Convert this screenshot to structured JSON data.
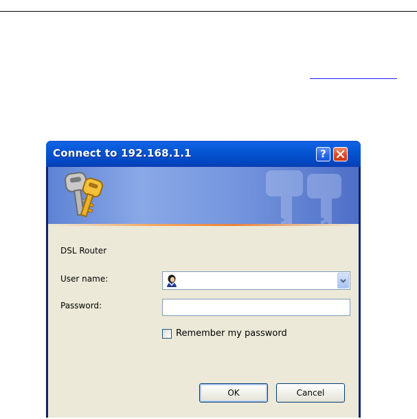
{
  "dialog": {
    "title": "Connect to 192.168.1.1",
    "help_button": "?",
    "realm": "DSL Router",
    "user_name_label": "User name:",
    "user_name_value": "",
    "password_label": "Password:",
    "password_value": "",
    "remember_label": "Remember my password",
    "remember_checked": false,
    "ok_label": "OK",
    "cancel_label": "Cancel"
  },
  "icons": {
    "banner": "keys-icon",
    "user_field": "user-icon",
    "dropdown": "chevron-down-icon",
    "close": "close-icon",
    "help": "help-icon"
  },
  "colors": {
    "titlebar": "#0454d0",
    "close_button": "#dd4a25",
    "dialog_body": "#ece9d8",
    "banner_accent": "#e9823a"
  }
}
